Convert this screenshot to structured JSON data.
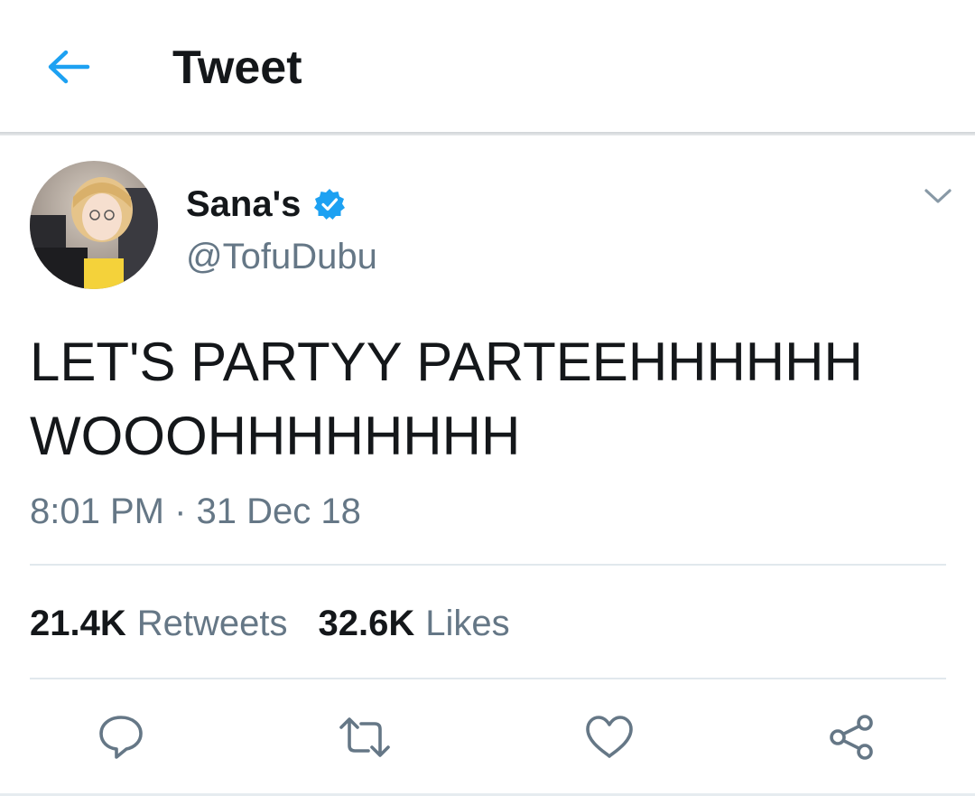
{
  "header": {
    "title": "Tweet",
    "back_icon": "arrow-left-icon",
    "accent_color": "#1da1f2"
  },
  "tweet": {
    "author": {
      "display_name": "Sana's",
      "handle": "@TofuDubu",
      "verified": true,
      "verified_icon": "verified-badge-icon"
    },
    "text_lines": [
      "LET'S PARTYY PARTEEHHHHHH",
      "WOOOHHHHHHHH"
    ],
    "timestamp": "8:01 PM · 31 Dec 18",
    "menu_icon": "chevron-down-icon"
  },
  "stats": {
    "retweets": {
      "count": "21.4K",
      "label": "Retweets"
    },
    "likes": {
      "count": "32.6K",
      "label": "Likes"
    }
  },
  "actions": [
    {
      "name": "reply",
      "icon": "comment-icon"
    },
    {
      "name": "retweet",
      "icon": "retweet-icon"
    },
    {
      "name": "like",
      "icon": "heart-icon"
    },
    {
      "name": "share",
      "icon": "share-icon"
    }
  ],
  "colors": {
    "text_primary": "#14171a",
    "text_secondary": "#657786",
    "divider": "#e1e8ed",
    "icon_gray": "#657786"
  }
}
